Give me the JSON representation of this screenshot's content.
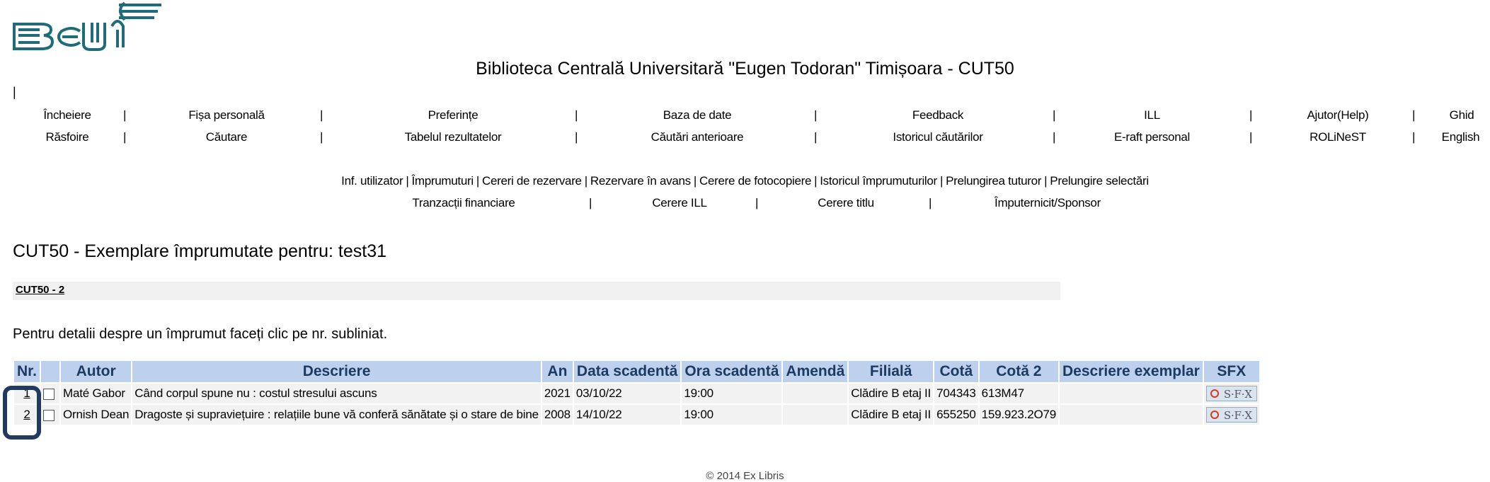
{
  "site_title": "Biblioteca Centrală Universitară \"Eugen Todoran\" Timișoara - CUT50",
  "stray_separator": "|",
  "nav": {
    "row1": [
      "Încheiere",
      "Fișa personală",
      "Preferințe",
      "Baza de date",
      "Feedback",
      "ILL",
      "Ajutor(Help)",
      "Ghid"
    ],
    "row2": [
      "Răsfoire",
      "Căutare",
      "Tabelul rezultatelor",
      "Căutări anterioare",
      "Istoricul căutărilor",
      "E-raft personal",
      "ROLiNeST",
      "English"
    ],
    "separator": "|"
  },
  "subnav": {
    "row1": [
      "Inf. utilizator",
      "Împrumuturi",
      "Cereri de rezervare",
      "Rezervare în avans",
      "Cerere de fotocopiere",
      "Istoricul împrumuturilor",
      "Prelungirea tuturor",
      "Prelungire selectări"
    ],
    "row2": [
      "Tranzacții financiare",
      "Cerere ILL",
      "Cerere titlu",
      "Împuternicit/Sponsor"
    ]
  },
  "page_heading": "CUT50 - Exemplare împrumutate pentru: test31",
  "section_link": "CUT50 - 2",
  "hint": "Pentru detalii despre un împrumut faceți clic pe nr. subliniat.",
  "table": {
    "headers": [
      "Nr.",
      "",
      "Autor",
      "Descriere",
      "An",
      "Data scadentă",
      "Ora scadentă",
      "Amendă",
      "Filială",
      "Cotă",
      "Cotă 2",
      "Descriere exemplar",
      "SFX"
    ],
    "rows": [
      {
        "nr": "1",
        "autor": "Maté Gabor",
        "descriere": "Când corpul spune nu : costul stresului ascuns",
        "an": "2021",
        "data": "03/10/22",
        "ora": "19:00",
        "amenda": "",
        "filiala": "Clădire B etaj II",
        "cota": "704343",
        "cota2": "613M47",
        "descriere_ex": "",
        "sfx": "S·F·X"
      },
      {
        "nr": "2",
        "autor": "Ornish Dean",
        "descriere": "Dragoste și supraviețuire : relațiile bune vă conferă sănătate și o stare de bine",
        "an": "2008",
        "data": "14/10/22",
        "ora": "19:00",
        "amenda": "",
        "filiala": "Clădire B etaj II",
        "cota": "655250",
        "cota2": "159.923.2O79",
        "descriere_ex": "",
        "sfx": "S·F·X"
      }
    ]
  },
  "footer": "© 2014 Ex Libris",
  "colors": {
    "header_bg": "#bdd1ee",
    "header_text": "#1e3a60",
    "highlight": "#223a5e",
    "logo": "#1f6b78"
  }
}
